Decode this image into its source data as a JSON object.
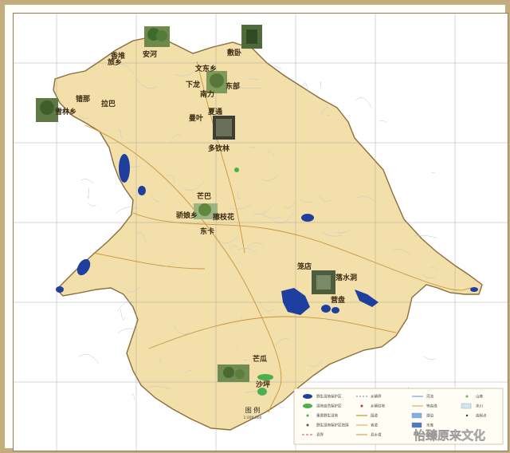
{
  "map": {
    "colors": {
      "land": "#f2dfa9",
      "land_edge": "#8a6d3b",
      "outside": "#ffffff",
      "water": "#1e3f9e",
      "wetland_green": "#4caf50",
      "grid": "#9a9a9a",
      "roads": "#c9953a",
      "streams": "#b9c7d6"
    },
    "places": [
      {
        "id": "xiangyun",
        "name": "香堆"
      },
      {
        "id": "anyuan",
        "name": "安河"
      },
      {
        "id": "xiangchang",
        "name": "旅乡"
      },
      {
        "id": "wendong",
        "name": "文东乡"
      },
      {
        "id": "xiankuo",
        "name": "敷卧"
      },
      {
        "id": "dongbu",
        "name": "东部"
      },
      {
        "id": "xiaolong",
        "name": "下龙"
      },
      {
        "id": "nanla",
        "name": "南力"
      },
      {
        "id": "laba",
        "name": "拉巴"
      },
      {
        "id": "xuelin",
        "name": "雪林乡"
      },
      {
        "id": "tsona",
        "name": "错那"
      },
      {
        "id": "xiatong",
        "name": "夏通"
      },
      {
        "id": "manshi",
        "name": "曼叶"
      },
      {
        "id": "duo",
        "name": "多钦林"
      },
      {
        "id": "maoba",
        "name": "芒巴"
      },
      {
        "id": "jiaolong",
        "name": "骄娘乡"
      },
      {
        "id": "baiyi",
        "name": "擦枝花"
      },
      {
        "id": "dongka",
        "name": "东卡"
      },
      {
        "id": "longlong",
        "name": "笼店"
      },
      {
        "id": "luoshui",
        "name": "落水洞"
      },
      {
        "id": "yanhai",
        "name": "营盘"
      },
      {
        "id": "manga",
        "name": "芒瓜"
      },
      {
        "id": "shaping",
        "name": "沙坪"
      }
    ],
    "legend": {
      "title": "图 例",
      "scale": "1:200,000",
      "items": [
        "野生湿地保护区",
        "湿地自然保护区",
        "重要野生湿地",
        "野生湿地保护区范围",
        "县界",
        "乡镇界",
        "乡镇驻地",
        "国道",
        "省道",
        "县乡道",
        "河流",
        "等高线",
        "湖泊",
        "水库",
        "村庄",
        "山峰",
        "冰川",
        "高程点"
      ]
    },
    "watermark": "怡臻原来文化"
  }
}
